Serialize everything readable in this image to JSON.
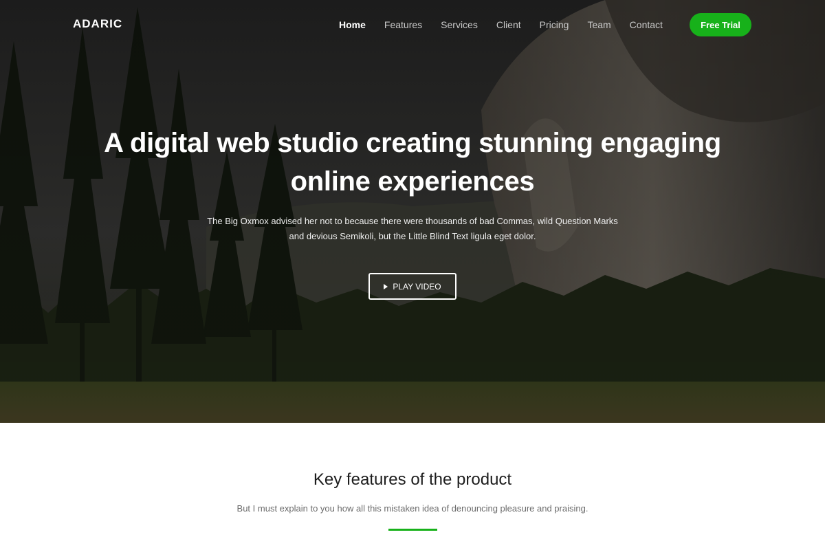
{
  "brand": {
    "name": "ADARIC"
  },
  "nav": {
    "items": [
      {
        "label": "Home",
        "active": true
      },
      {
        "label": "Features",
        "active": false
      },
      {
        "label": "Services",
        "active": false
      },
      {
        "label": "Client",
        "active": false
      },
      {
        "label": "Pricing",
        "active": false
      },
      {
        "label": "Team",
        "active": false
      },
      {
        "label": "Contact",
        "active": false
      }
    ],
    "cta_label": "Free Trial"
  },
  "hero": {
    "title": "A digital web studio creating stunning engaging online experiences",
    "subtitle": "The Big Oxmox advised her not to because there were thousands of bad Commas, wild Question Marks and devious Semikoli, but the Little Blind Text ligula eget dolor.",
    "play_label": "PLAY VIDEO",
    "play_icon": "play-icon"
  },
  "features": {
    "title": "Key features of the product",
    "subtitle": "But I must explain to you how all this mistaken idea of denouncing pleasure and praising."
  },
  "colors": {
    "accent": "#17b11a",
    "hero_overlay": "#1c1c1c",
    "heading": "#1d1d1d",
    "muted": "#6b6b6b"
  }
}
